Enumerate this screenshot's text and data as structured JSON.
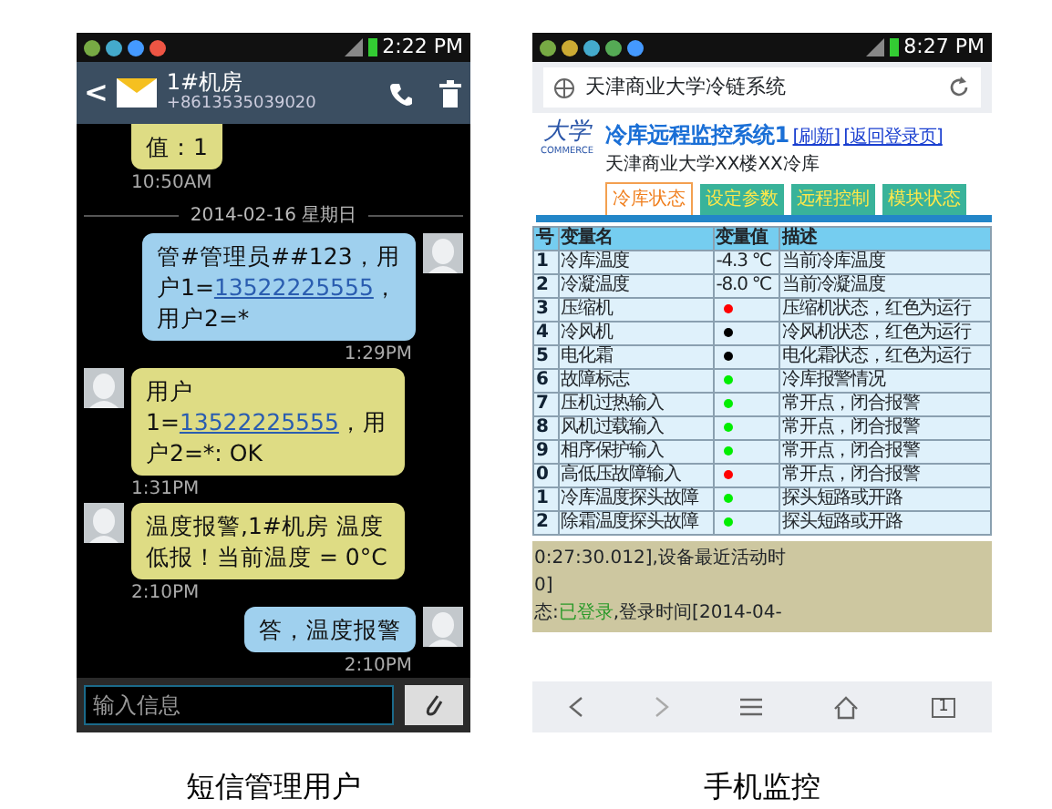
{
  "sms_phone": {
    "status_bar": {
      "time": "2:22 PM"
    },
    "header": {
      "back": "<",
      "contact": "1#机房",
      "number": "+8613535039020"
    },
    "messages": [
      {
        "kind": "received",
        "parts": [
          {
            "text": "值：1",
            "link": false
          }
        ],
        "time": "10:50AM"
      },
      {
        "kind": "divider",
        "text": "2014-02-16 星期日"
      },
      {
        "kind": "sent",
        "parts": [
          {
            "text": "管#管理员##123，用户1=",
            "link": false
          },
          {
            "text": "13522225555",
            "link": true
          },
          {
            "text": "，用户2=*",
            "link": false
          }
        ],
        "time": "1:29PM"
      },
      {
        "kind": "received",
        "parts": [
          {
            "text": "用户1=",
            "link": false
          },
          {
            "text": "13522225555",
            "link": true
          },
          {
            "text": "，用户2=*: OK",
            "link": false
          }
        ],
        "time": "1:31PM"
      },
      {
        "kind": "received",
        "parts": [
          {
            "text": "温度报警,1#机房 温度低报！当前温度 = 0°C",
            "link": false
          }
        ],
        "time": "2:10PM"
      },
      {
        "kind": "sent",
        "parts": [
          {
            "text": "答，温度报警",
            "link": false
          }
        ],
        "time": "2:10PM"
      }
    ],
    "input": {
      "placeholder": "输入信息"
    },
    "caption": "短信管理用户"
  },
  "web_phone": {
    "status_bar": {
      "time": "8:27 PM"
    },
    "url_bar": {
      "text": "天津商业大学冷链系统"
    },
    "logo": {
      "text": "大学",
      "caption": "COMMERCE"
    },
    "title": "冷库远程监控系统1",
    "links": [
      "[刷新]",
      "[返回登录页]"
    ],
    "subtitle": "天津商业大学XX楼XX冷库",
    "tabs": [
      {
        "label": "冷库状态",
        "selected": true
      },
      {
        "label": "设定参数",
        "selected": false
      },
      {
        "label": "远程控制",
        "selected": false
      },
      {
        "label": "模块状态",
        "selected": false
      }
    ],
    "table": {
      "columns": [
        "号",
        "变量名",
        "变量值",
        "描述"
      ],
      "rows": [
        {
          "number": "1",
          "name": "冷库温度",
          "kind": "reading",
          "value": "-4.3 ℃",
          "description": "当前冷库温度"
        },
        {
          "number": "2",
          "name": "冷凝温度",
          "kind": "reading",
          "value": "-8.0 ℃",
          "description": "当前冷凝温度"
        },
        {
          "number": "3",
          "name": "压缩机",
          "kind": "indicator",
          "color": "#ff0000",
          "description": "压缩机状态，红色为运行"
        },
        {
          "number": "4",
          "name": "冷风机",
          "kind": "indicator",
          "color": "#000000",
          "description": "冷风机状态，红色为运行"
        },
        {
          "number": "5",
          "name": "电化霜",
          "kind": "indicator",
          "color": "#000000",
          "description": "电化霜状态，红色为运行"
        },
        {
          "number": "6",
          "name": "故障标志",
          "kind": "indicator",
          "color": "#00ee00",
          "description": "冷库报警情况"
        },
        {
          "number": "7",
          "name": "压机过热输入",
          "kind": "indicator",
          "color": "#00ee00",
          "description": "常开点，闭合报警"
        },
        {
          "number": "8",
          "name": "风机过载输入",
          "kind": "indicator",
          "color": "#00ee00",
          "description": "常开点，闭合报警"
        },
        {
          "number": "9",
          "name": "相序保护输入",
          "kind": "indicator",
          "color": "#00ee00",
          "description": "常开点，闭合报警"
        },
        {
          "number": "0",
          "name": "高低压故障输入",
          "kind": "indicator",
          "color": "#ff0000",
          "description": "常开点，闭合报警"
        },
        {
          "number": "1",
          "name": "冷库温度探头故障",
          "kind": "indicator",
          "color": "#00ee00",
          "description": "探头短路或开路"
        },
        {
          "number": "2",
          "name": "除霜温度探头故障",
          "kind": "indicator",
          "color": "#00ee00",
          "description": "探头短路或开路"
        }
      ]
    },
    "status_lines": [
      [
        {
          "text": "0:27:30.012],设备最近活动时",
          "kind": "plain"
        }
      ],
      [
        {
          "text": "0]",
          "kind": "plain"
        }
      ],
      [
        {
          "text": "态:",
          "kind": "plain"
        },
        {
          "text": "已登录",
          "kind": "status"
        },
        {
          "text": ",登录时间[2014-04-",
          "kind": "plain"
        }
      ]
    ],
    "nav": {
      "tab_count": "1"
    },
    "caption": "手机监控"
  }
}
